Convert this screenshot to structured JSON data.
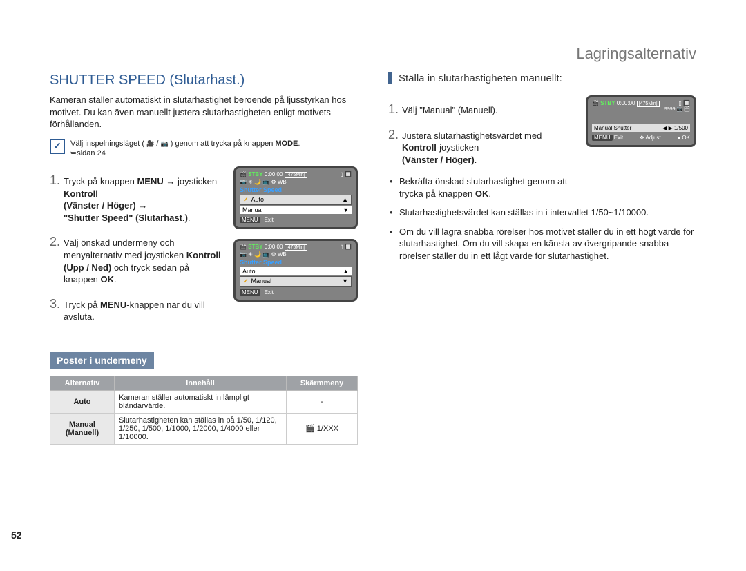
{
  "header": {
    "section": "Lagringsalternativ"
  },
  "page_number": "52",
  "left": {
    "title": "SHUTTER SPEED (Slutarhast.)",
    "intro": "Kameran ställer automatiskt in slutarhastighet beroende på ljusstyrkan hos motivet. Du kan även manuellt justera slutarhastigheten enligt motivets förhållanden.",
    "note_pre": "Välj inspelningsläget ( ",
    "note_mid": " / ",
    "note_post": " ) genom att trycka på knappen ",
    "note_mode": "MODE",
    "note_page": "➥sidan 24",
    "steps": {
      "s1_a": "Tryck på knappen ",
      "s1_menu": "MENU",
      "s1_b": "joysticken ",
      "s1_kontroll": "Kontroll",
      "s1_vh": "(Vänster / Höger)",
      "s1_ss": "\"Shutter Speed\" (Slutarhast.)",
      "s2_a": "Välj önskad undermeny och menyalternativ med joysticken ",
      "s2_kun": "Kontroll (Upp / Ned)",
      "s2_b": " och tryck sedan på knappen ",
      "s2_ok": "OK",
      "s3_a": "Tryck på ",
      "s3_menu": "MENU",
      "s3_b": "-knappen när du vill avsluta."
    },
    "screen1": {
      "stby": "STBY",
      "time_count": "0:00:00",
      "time_remain": "[475Min]",
      "title": "Shutter Speed",
      "item1": "Auto",
      "item2": "Manual",
      "menu_btn": "MENU",
      "exit": "Exit"
    },
    "screen2": {
      "stby": "STBY",
      "time_count": "0:00:00",
      "time_remain": "[475Min]",
      "title": "Shutter Speed",
      "item1": "Auto",
      "item2": "Manual",
      "menu_btn": "MENU",
      "exit": "Exit"
    },
    "sub_heading": "Poster i undermeny",
    "table": {
      "h1": "Alternativ",
      "h2": "Innehåll",
      "h3": "Skärmmeny",
      "r1c1": "Auto",
      "r1c2": "Kameran ställer automatiskt in lämpligt bländarvärde.",
      "r1c3": "-",
      "r2c1_a": "Manual",
      "r2c1_b": "(Manuell)",
      "r2c2": "Slutarhastigheten kan ställas in på 1/50, 1/120, 1/250, 1/500, 1/1000, 1/2000, 1/4000 eller 1/10000.",
      "r2c3": "🎬 1/XXX"
    }
  },
  "right": {
    "title": "Ställa in slutarhastigheten manuellt:",
    "steps": {
      "s1": "Välj \"Manual\" (Manuell).",
      "s2_a": "Justera slutarhastighetsvärdet med ",
      "s2_b": "Kontroll",
      "s2_c": "-joysticken ",
      "s2_d": "(Vänster / Höger)"
    },
    "bullets": {
      "b1_a": "Bekräfta önskad slutarhastighet genom att trycka på knappen ",
      "b1_b": "OK",
      "b2": "Slutarhastighetsvärdet kan ställas in i intervallet 1/50~1/10000.",
      "b3": "Om du vill lagra snabba rörelser hos motivet ställer du in ett högt värde för slutarhastighet. Om du vill skapa en känsla av övergripande snabba rörelser ställer du in ett lågt värde för slutarhastighet."
    },
    "screen": {
      "stby": "STBY",
      "time_count": "0:00:00",
      "time_remain": "[475Min]",
      "count": "9999",
      "manual_label": "Manual Shutter",
      "value": "1/500",
      "menu_btn": "MENU",
      "exit": "Exit",
      "adjust": "Adjust",
      "ok": "OK"
    }
  }
}
